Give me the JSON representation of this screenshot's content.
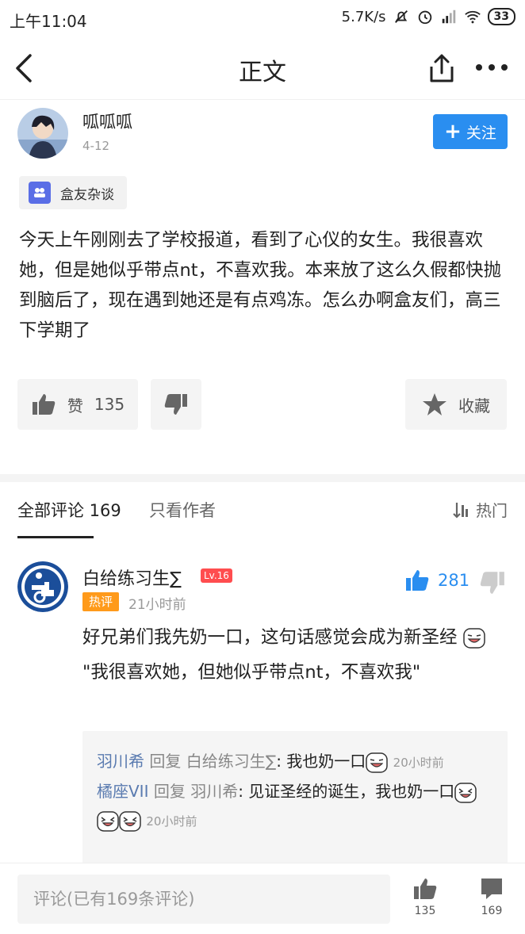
{
  "status_bar": {
    "time": "上午11:04",
    "network_speed": "5.7K/s",
    "battery": "33"
  },
  "nav": {
    "title": "正文"
  },
  "post": {
    "author": "呱呱呱",
    "date": "4-12",
    "follow_label": "关注",
    "tag": "盒友杂谈",
    "body": "今天上午刚刚去了学校报道，看到了心仪的女生。我很喜欢她，但是她似乎带点nt，不喜欢我。本来放了这么久假都快抛到脑后了，现在遇到她还是有点鸡冻。怎么办啊盒友们，高三下学期了",
    "like_label": "赞",
    "like_count": "135",
    "collect_label": "收藏"
  },
  "comments_header": {
    "all_tab": "全部评论 169",
    "author_only_tab": "只看作者",
    "sort_label": "热门"
  },
  "comment": {
    "user": "白给练习生∑",
    "level": "Lv.16",
    "hot_badge": "热评",
    "time": "21小时前",
    "like_count": "281",
    "line1": "好兄弟们我先奶一口，这句话感觉会成为新圣经",
    "line2": "\"我很喜欢她，但她似乎带点nt，不喜欢我\"",
    "replies": [
      {
        "user": "羽川希",
        "reply_word": "回复",
        "target": "白给练习生∑",
        "text": ": 我也奶一口",
        "time": "20小时前"
      },
      {
        "user": "橘座VII",
        "reply_word": "回复",
        "target": "羽川希",
        "text": ": 见证圣经的诞生，我也奶一口",
        "time": "20小时前"
      }
    ]
  },
  "bottom_bar": {
    "input_placeholder": "评论(已有169条评论)",
    "like_count": "135",
    "comment_count": "169"
  },
  "colors": {
    "accent_blue": "#2a8ef0",
    "hot_orange": "#ff9a1a",
    "level_red": "#ff4d4f",
    "reply_user_blue": "#5a7bb0"
  }
}
